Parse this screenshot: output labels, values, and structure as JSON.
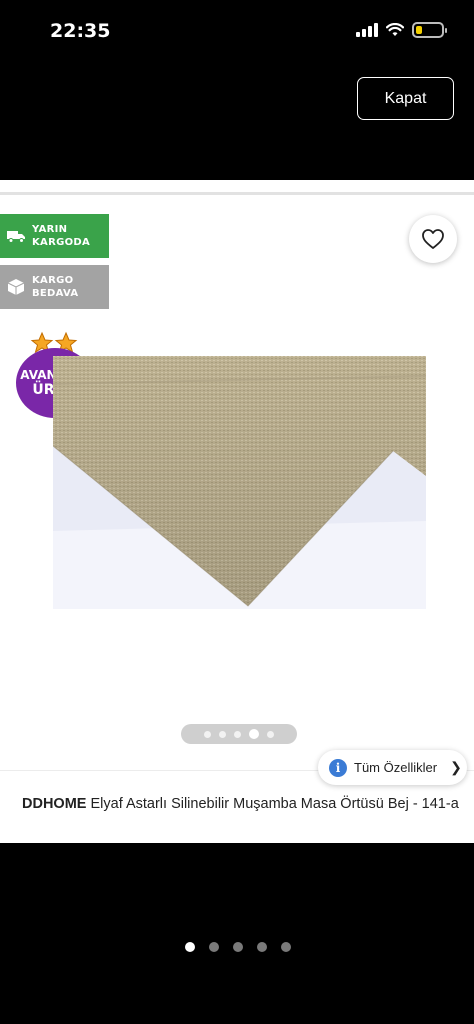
{
  "status_bar": {
    "time": "22:35",
    "battery_level": 0.25,
    "battery_color": "#f4d000"
  },
  "modal": {
    "close_label": "Kapat"
  },
  "badges": {
    "shipping_tomorrow": {
      "line1": "YARIN",
      "line2": "KARGODA",
      "color": "#3aa34a",
      "icon": "truck-icon"
    },
    "free_shipping": {
      "line1": "KARGO",
      "line2": "BEDAVA",
      "color": "#a3a3a3",
      "icon": "box-icon"
    }
  },
  "favorite": {
    "icon": "heart-icon"
  },
  "advantage_badge": {
    "line1": "AVANTAJLI",
    "line2": "ÜRÜN",
    "color": "#7a27a8"
  },
  "gallery": {
    "image_count": 5,
    "active_index": 3
  },
  "all_features": {
    "label": "Tüm Özellikler",
    "icon": "info-icon"
  },
  "product": {
    "brand": "DDHOME",
    "name": "Elyaf Astarlı Silinebilir Muşamba Masa Örtüsü Bej - 141-a"
  },
  "page_indicator": {
    "count": 5,
    "active_index": 0
  }
}
